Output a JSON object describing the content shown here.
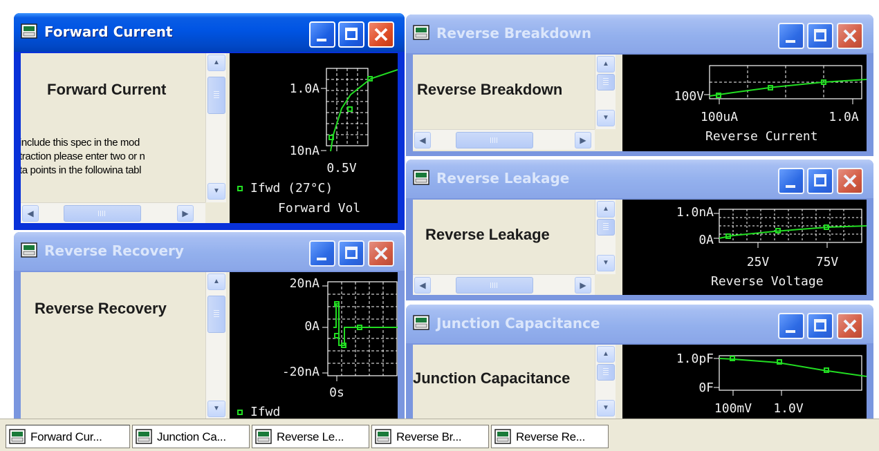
{
  "windows": {
    "forward_current": {
      "title": "Forward Current",
      "spec_title": "Forward Current",
      "instructions": [
        " include this spec in the mod",
        "traction please enter two or n",
        "ta points in the followina tabl"
      ],
      "plot": {
        "y_ticks": [
          "1.0A",
          "10nA"
        ],
        "x_tick": "0.5V",
        "legend": "Ifwd (27°C)",
        "x_label": "Forward Vol"
      }
    },
    "reverse_recovery": {
      "title": "Reverse Recovery",
      "spec_title": "Reverse Recovery",
      "plot": {
        "y_ticks": [
          "20nA",
          "0A",
          "-20nA"
        ],
        "x_tick": "0s",
        "legend": "Ifwd"
      }
    },
    "reverse_breakdown": {
      "title": "Reverse Breakdown",
      "spec_title": "Reverse Breakdown",
      "plot": {
        "y_tick": "100V",
        "x_ticks": [
          "100uA",
          "1.0A"
        ],
        "x_label": "Reverse Current"
      }
    },
    "reverse_leakage": {
      "title": "Reverse Leakage",
      "spec_title": "Reverse Leakage",
      "plot": {
        "y_ticks": [
          "1.0nA",
          "0A"
        ],
        "x_ticks": [
          "25V",
          "75V"
        ],
        "x_label": "Reverse Voltage"
      }
    },
    "junction_capacitance": {
      "title": "Junction Capacitance",
      "spec_title": "Junction Capacitance",
      "plot": {
        "y_ticks": [
          "1.0pF",
          "0F"
        ],
        "x_ticks": [
          "100mV",
          "1.0V"
        ]
      }
    }
  },
  "taskbar": {
    "items": [
      "Forward Cur...",
      "Junction Ca...",
      "Reverse Le...",
      "Reverse Br...",
      "Reverse Re..."
    ]
  },
  "colors": {
    "active_titlebar": "#0054e3",
    "inactive_titlebar": "#93b0ed",
    "close_button": "#de4d26",
    "plot_background": "#000000",
    "plot_trace": "#22dd22"
  }
}
